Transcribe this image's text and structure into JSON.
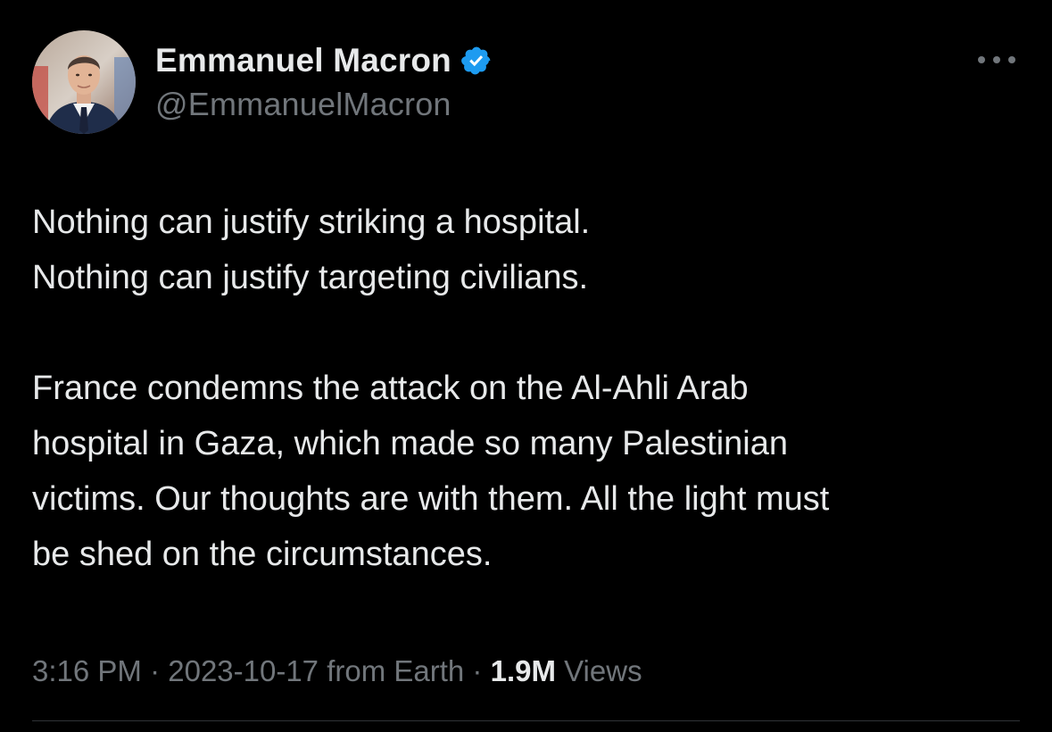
{
  "author": {
    "display_name": "Emmanuel Macron",
    "handle": "@EmmanuelMacron",
    "verified": true,
    "verified_color": "#1d9bf0"
  },
  "tweet": {
    "lines": [
      "Nothing can justify striking a hospital.",
      "Nothing can justify targeting civilians.",
      "",
      "France condemns the attack on the Al-Ahli Arab",
      "hospital in Gaza, which made so many Palestinian",
      "victims. Our thoughts are with them. All the light must",
      "be shed on the circumstances."
    ]
  },
  "meta": {
    "time": "3:16 PM",
    "separator": " · ",
    "date": "2023-10-17",
    "source": "from Earth",
    "views_count": "1.9M",
    "views_label": "Views"
  },
  "icons": {
    "more": "more-horizontal-icon",
    "verified": "verified-badge-icon"
  },
  "colors": {
    "background": "#000000",
    "primary_text": "#e7e9ea",
    "secondary_text": "#71767b",
    "divider": "#2f3336"
  }
}
